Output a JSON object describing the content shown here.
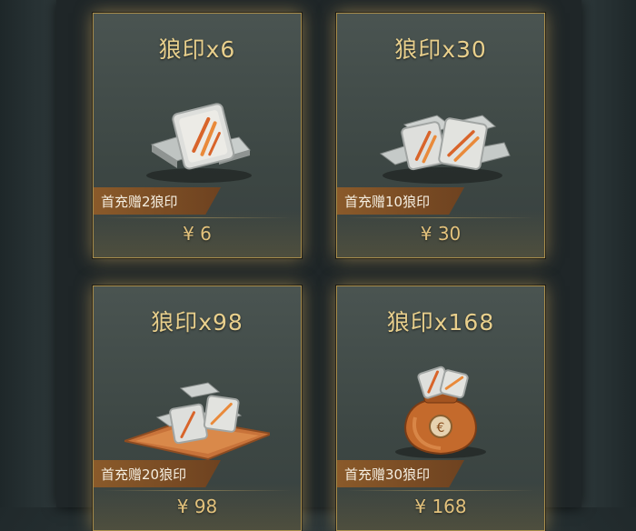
{
  "shop": {
    "products": [
      {
        "title": "狼印x6",
        "bonus": "首充赠2狼印",
        "price": "¥ 6",
        "icon": "small-stack-icon"
      },
      {
        "title": "狼印x30",
        "bonus": "首充赠10狼印",
        "price": "¥ 30",
        "icon": "pile-icon"
      },
      {
        "title": "狼印x98",
        "bonus": "首充赠20狼印",
        "price": "¥ 98",
        "icon": "tray-pile-icon"
      },
      {
        "title": "狼印x168",
        "bonus": "首充赠30狼印",
        "price": "¥ 168",
        "icon": "money-bag-icon"
      }
    ]
  },
  "colors": {
    "title_gold": "#e8cf8c",
    "badge_brown": "#7a4c24",
    "card_border": "#a88d4b"
  }
}
